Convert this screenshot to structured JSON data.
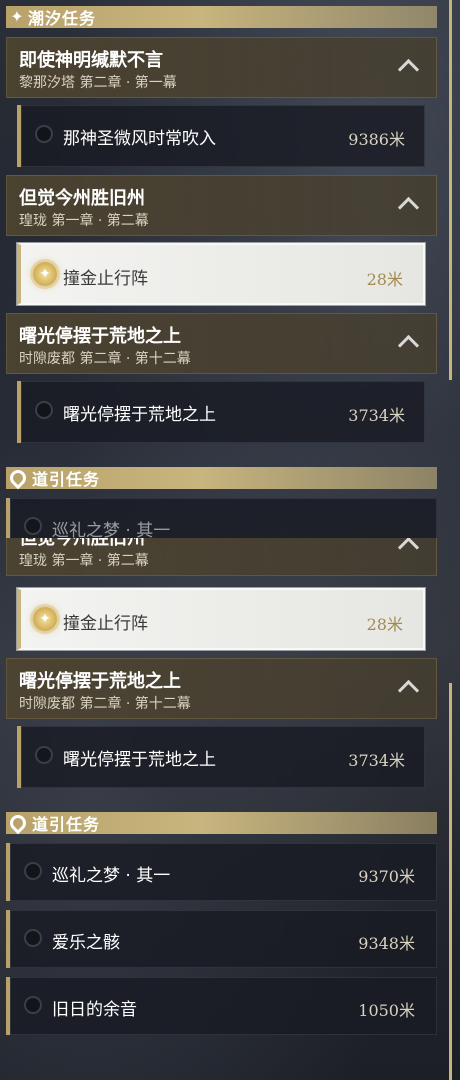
{
  "panel_a": {
    "tide_section_title": "潮汐任务",
    "groups": [
      {
        "title": "即使神明缄默不言",
        "subtitle": "黎那汐塔 第二章 · 第一幕",
        "task": {
          "name": "那神圣微风时常吹入",
          "distance": "9386米"
        }
      },
      {
        "title": "但觉今州胜旧州",
        "subtitle": "瑝珑 第一章 · 第二幕",
        "task": {
          "name": "撞金止行阵",
          "distance": "28米",
          "active": true
        }
      },
      {
        "title": "曙光停摆于荒地之上",
        "subtitle": "时隙废都 第二章 · 第十二幕",
        "task": {
          "name": "曙光停摆于荒地之上",
          "distance": "3734米"
        }
      }
    ],
    "guide_section_title": "道引任务",
    "partial_item_text": "巡礼之梦 · 其一"
  },
  "panel_b": {
    "partial_group_title": "但觉今州胜旧州",
    "groups": [
      {
        "subtitle": "瑝珑 第一章 · 第二幕",
        "task": {
          "name": "撞金止行阵",
          "distance": "28米",
          "active": true
        }
      },
      {
        "title": "曙光停摆于荒地之上",
        "subtitle": "时隙废都 第二章 · 第十二幕",
        "task": {
          "name": "曙光停摆于荒地之上",
          "distance": "3734米"
        }
      }
    ],
    "guide_section_title": "道引任务",
    "guide_tasks": [
      {
        "name": "巡礼之梦 · 其一",
        "distance": "9370米"
      },
      {
        "name": "爱乐之骸",
        "distance": "9348米"
      },
      {
        "name": "旧日的余音",
        "distance": "1050米"
      }
    ]
  },
  "icons": {
    "tide": "sparkle-icon",
    "guide": "map-pin-icon",
    "collapse": "chevron-up-icon",
    "active_task": "compass-icon"
  },
  "colors": {
    "accent_gold": "#c8b57e",
    "active_distance": "#a48a4e"
  }
}
